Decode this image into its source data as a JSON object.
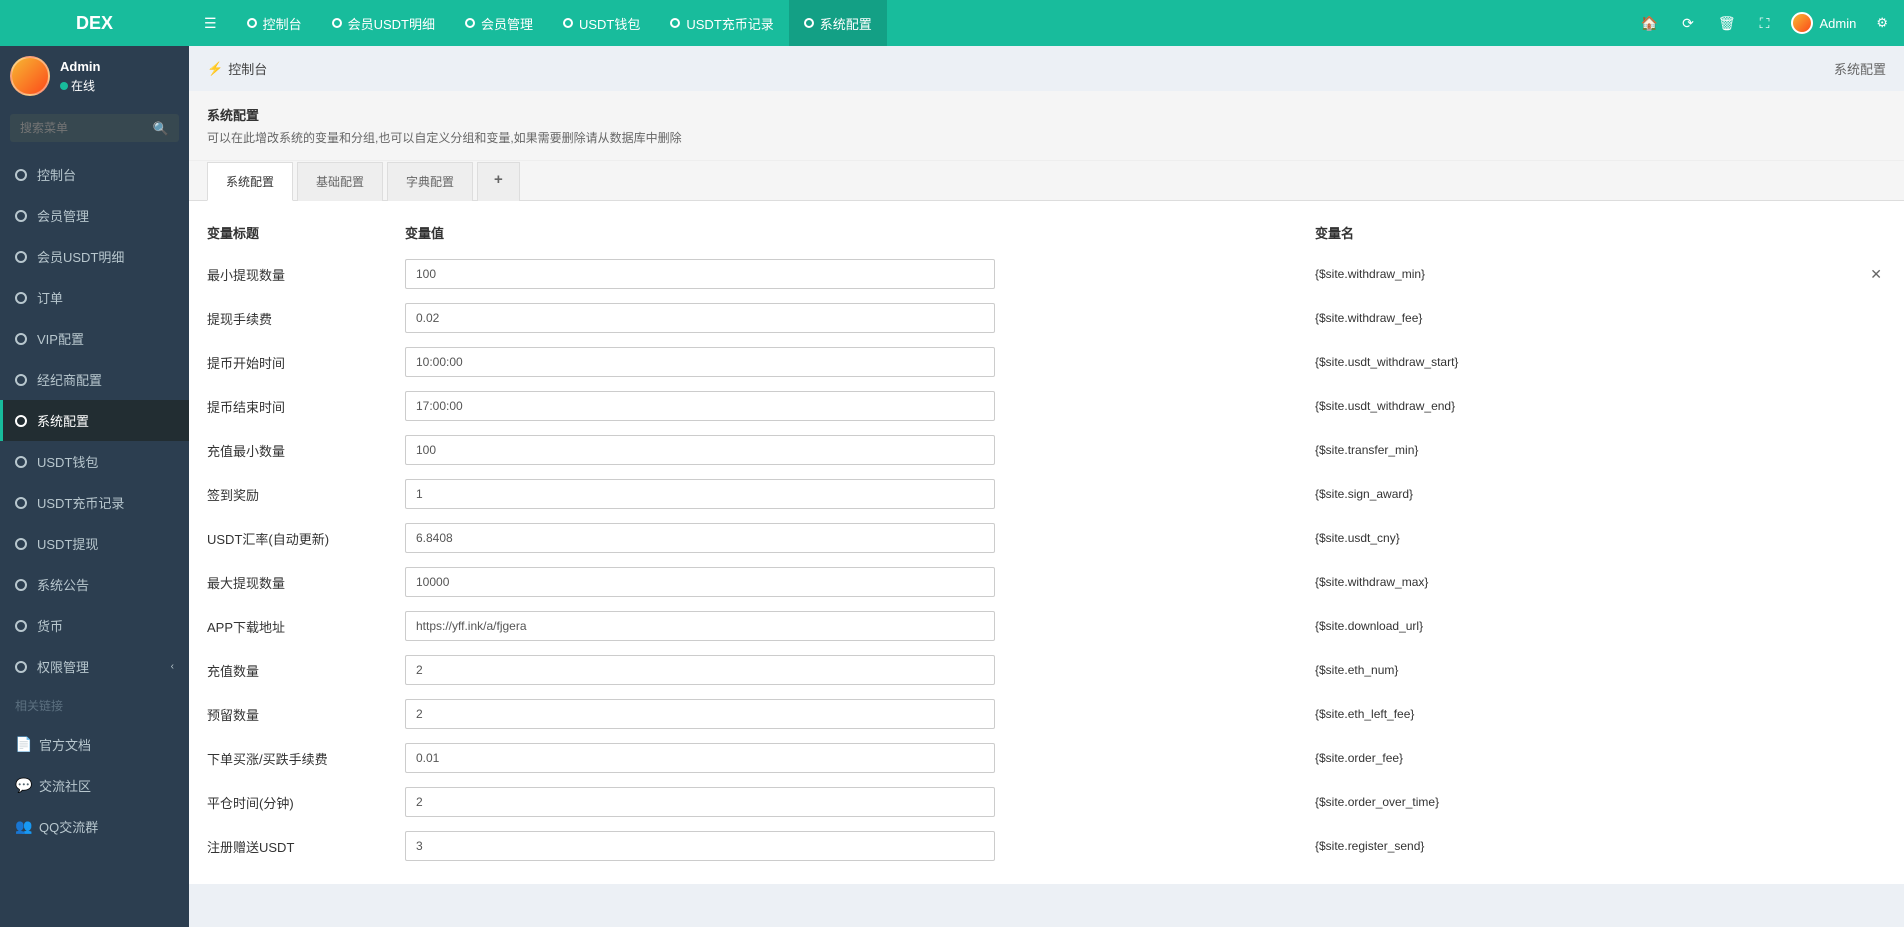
{
  "brand": "DEX",
  "topnav": {
    "tabs": [
      {
        "label": "控制台"
      },
      {
        "label": "会员USDT明细"
      },
      {
        "label": "会员管理"
      },
      {
        "label": "USDT钱包"
      },
      {
        "label": "USDT充币记录"
      },
      {
        "label": "系统配置",
        "active": true
      }
    ],
    "user": "Admin"
  },
  "sidebar": {
    "user": {
      "name": "Admin",
      "status": "在线"
    },
    "search_placeholder": "搜索菜单",
    "items": [
      {
        "label": "控制台"
      },
      {
        "label": "会员管理"
      },
      {
        "label": "会员USDT明细"
      },
      {
        "label": "订单"
      },
      {
        "label": "VIP配置"
      },
      {
        "label": "经纪商配置"
      },
      {
        "label": "系统配置",
        "active": true
      },
      {
        "label": "USDT钱包"
      },
      {
        "label": "USDT充币记录"
      },
      {
        "label": "USDT提现"
      },
      {
        "label": "系统公告"
      },
      {
        "label": "货币"
      },
      {
        "label": "权限管理",
        "hasChildren": true
      }
    ],
    "links_header": "相关链接",
    "ext": [
      {
        "label": "官方文档",
        "color": "#e67e22",
        "icon": "📄"
      },
      {
        "label": "交流社区",
        "color": "#e74c3c",
        "icon": "💬"
      },
      {
        "label": "QQ交流群",
        "color": "#3498db",
        "icon": "👥"
      }
    ]
  },
  "breadcrumb": {
    "home": "控制台",
    "current": "系统配置"
  },
  "panel": {
    "title": "系统配置",
    "desc": "可以在此增改系统的变量和分组,也可以自定义分组和变量,如果需要删除请从数据库中删除",
    "tabs": [
      {
        "label": "系统配置",
        "active": true
      },
      {
        "label": "基础配置"
      },
      {
        "label": "字典配置"
      }
    ],
    "columns": {
      "title": "变量标题",
      "value": "变量值",
      "name": "变量名"
    },
    "rows": [
      {
        "title": "最小提现数量",
        "value": "100",
        "name": "{$site.withdraw_min}",
        "closable": true
      },
      {
        "title": "提现手续费",
        "value": "0.02",
        "name": "{$site.withdraw_fee}"
      },
      {
        "title": "提币开始时间",
        "value": "10:00:00",
        "name": "{$site.usdt_withdraw_start}"
      },
      {
        "title": "提币结束时间",
        "value": "17:00:00",
        "name": "{$site.usdt_withdraw_end}"
      },
      {
        "title": "充值最小数量",
        "value": "100",
        "name": "{$site.transfer_min}"
      },
      {
        "title": "签到奖励",
        "value": "1",
        "name": "{$site.sign_award}"
      },
      {
        "title": "USDT汇率(自动更新)",
        "value": "6.8408",
        "name": "{$site.usdt_cny}"
      },
      {
        "title": "最大提现数量",
        "value": "10000",
        "name": "{$site.withdraw_max}"
      },
      {
        "title": "APP下载地址",
        "value": "https://yff.ink/a/fjgera",
        "name": "{$site.download_url}"
      },
      {
        "title": "充值数量",
        "value": "2",
        "name": "{$site.eth_num}"
      },
      {
        "title": "预留数量",
        "value": "2",
        "name": "{$site.eth_left_fee}"
      },
      {
        "title": "下单买涨/买跌手续费",
        "value": "0.01",
        "name": "{$site.order_fee}"
      },
      {
        "title": "平仓时间(分钟)",
        "value": "2",
        "name": "{$site.order_over_time}"
      },
      {
        "title": "注册赠送USDT",
        "value": "3",
        "name": "{$site.register_send}"
      }
    ]
  }
}
